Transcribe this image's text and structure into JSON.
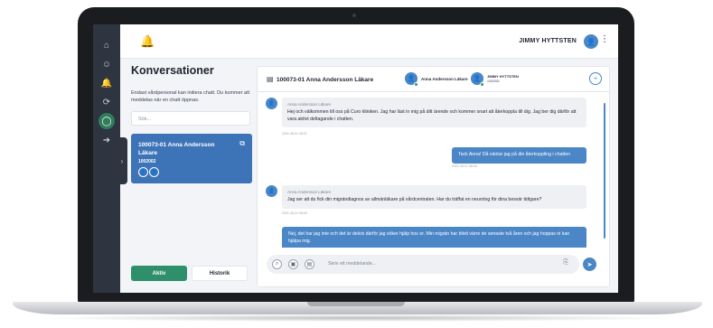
{
  "topbar": {
    "user_name": "JIMMY HYTTSTEN",
    "kebab": "⋮",
    "bell": "🔔"
  },
  "rail": {
    "icons": [
      "⌂",
      "☺",
      "🔔",
      "⟳",
      "◯",
      "➜"
    ]
  },
  "conversations": {
    "title": "Konversationer",
    "hint": "Endast vårdpersonal kan initiera chatt. Du kommer att meddelas när en chatt öppnas.",
    "search_placeholder": "Sök...",
    "collapse": "›",
    "card": {
      "title": "100073-01 Anna Andersson Läkare",
      "subtitle": "1002002",
      "open": "⧉"
    },
    "tabs": {
      "active": "Aktiv",
      "history": "Historik"
    }
  },
  "chat": {
    "title": "100073-01 Anna Andersson Läkare",
    "participant_1": "Anna Andersson Läkare",
    "participant_2_name": "JIMMY HYTTSTEN",
    "participant_2_id": "1002002",
    "add": "+",
    "messages": [
      {
        "sender": "Anna Andersson Läkare",
        "text": "Hej och välkommen till oss på Curo kliniken. Jag har läst in mig på ditt ärende och kommer snart att återkoppla till dig. Jag ber dig därför att vara aktivt deltagande i chatten.",
        "time": "2021-08-01 08:01"
      },
      {
        "sender": "",
        "text": "Tack Anna! Då väntar jag på din återkoppling i chatten",
        "time": "2021-08-01 08:05"
      },
      {
        "sender": "Anna Andersson Läkare",
        "text": "Jag ser att du fick din migrändiagnos av allmänläkare på vårdcentralen. Har du träffat en neurolog för dina besvär tidigare?",
        "time": "2021-08-01 08:09"
      },
      {
        "sender": "",
        "text": "Nej, det har jag inte och det är delvis därför jag söker hjälp hos er. Min migrän har blivit värre de senaste två åren och jag hoppas ni kan hjälpa mig.",
        "time": ""
      }
    ],
    "composer_placeholder": "Skriv ett meddelande...",
    "send": "➤"
  },
  "colors": {
    "accent_blue": "#4b86c6",
    "accent_green": "#2f8f6a",
    "alert_red": "#e05a4e",
    "rail_bg": "#2e3440"
  }
}
